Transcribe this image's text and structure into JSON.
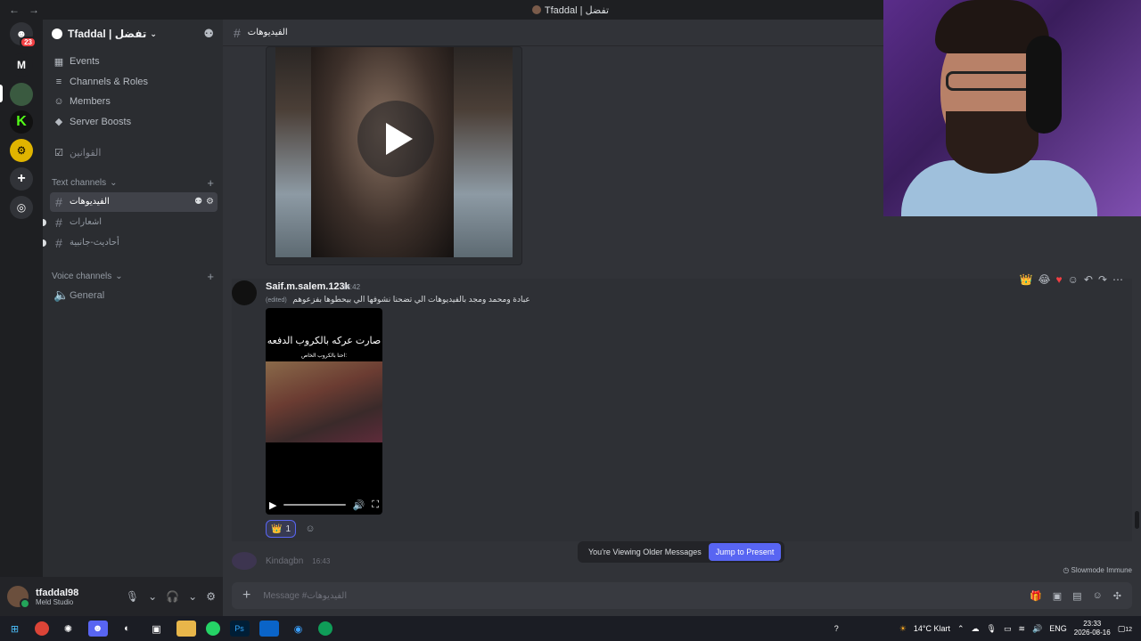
{
  "window": {
    "title": "Tfaddal | تفضل",
    "back": "←",
    "forward": "→"
  },
  "rail": {
    "dm_badge": "23",
    "servers": [
      {
        "initial": "M",
        "color": "#1e1f22"
      },
      {
        "initial": "",
        "color": "#3a5a40"
      },
      {
        "initial": "K",
        "color": "#111111"
      },
      {
        "initial": "",
        "color": "#e0b400"
      }
    ],
    "add_label": "+",
    "discover_label": "◎"
  },
  "guild": {
    "name": "Tfaddal | تفضل",
    "menu": [
      {
        "icon": "▦",
        "label": "Events"
      },
      {
        "icon": "≡",
        "label": "Channels & Roles"
      },
      {
        "icon": "☺",
        "label": "Members"
      },
      {
        "icon": "◆",
        "label": "Server Boosts"
      },
      {
        "icon": "☑",
        "label": "القوانين"
      }
    ],
    "text_category": "Text channels",
    "text_channels": [
      {
        "name": "الفيديوهات",
        "active": true
      },
      {
        "name": "اشعارات",
        "active": false
      },
      {
        "name": "أحاديث-جانبية",
        "active": false
      }
    ],
    "voice_category": "Voice channels",
    "voice_channels": [
      {
        "name": "General"
      }
    ]
  },
  "user": {
    "name": "tfaddal98",
    "status": "Meld Studio"
  },
  "channel": {
    "name": "الفيديوهات"
  },
  "message": {
    "author": "Saif.m.salem.123k",
    "time": "16:42",
    "edited": "(edited)",
    "text": "عبادة ومحمد ومجد بالفيديوهات الي تضحنا نشوفها  الي بيحطوها بفزعوهم",
    "video_caption_1": "صارت عركه بالكروب الدفعه",
    "video_caption_2": "احنا بالكروب الخاص:",
    "reaction_emoji": "👑",
    "reaction_count": "1"
  },
  "next_message": {
    "author": "Kindagbn",
    "time": "16:43"
  },
  "banner": {
    "text": "You're Viewing Older Messages",
    "button": "Jump to Present"
  },
  "slowmode": "Slowmode Immune",
  "composer": {
    "placeholder": "Message #الفيديوهات"
  },
  "taskbar": {
    "weather": "14°C  Klart",
    "lang": "ENG",
    "time": "23:33",
    "date": "2026-08-16",
    "notif": "12"
  }
}
